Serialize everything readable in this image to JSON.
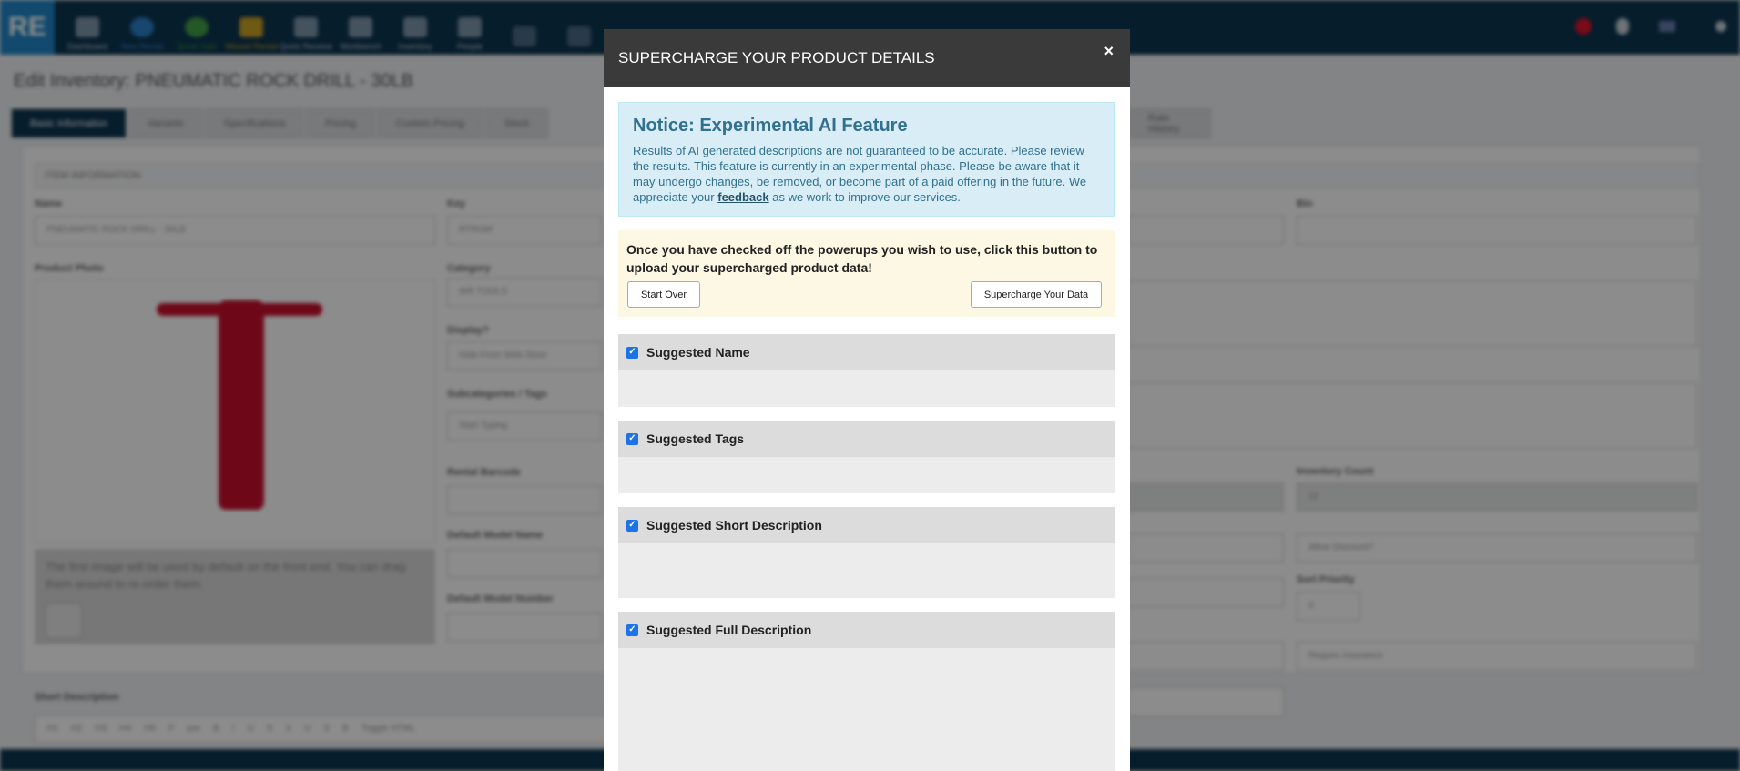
{
  "app": {
    "logo": "RE"
  },
  "nav": [
    {
      "label": "Dashboard",
      "icon": "dashboard-icon"
    },
    {
      "label": "New Rental",
      "icon": "new-rental-icon"
    },
    {
      "label": "Quick Sale",
      "icon": "quick-sale-icon"
    },
    {
      "label": "Missed Rental",
      "icon": "missed-rental-icon"
    },
    {
      "label": "Quick Receive",
      "icon": "quick-receive-icon"
    },
    {
      "label": "Workbench",
      "icon": "wrench-icon"
    },
    {
      "label": "Inventory",
      "icon": "inventory-icon"
    },
    {
      "label": "People",
      "icon": "people-icon"
    }
  ],
  "page": {
    "title": "Edit Inventory: PNEUMATIC ROCK DRILL - 30LB"
  },
  "tabs": [
    "Basic Information",
    "Variants",
    "Specifications",
    "Pricing",
    "Custom Pricing",
    "Stock",
    "Rate History"
  ],
  "form": {
    "section": "ITEM INFORMATION",
    "name_label": "Name",
    "name_value": "PNEUMATIC ROCK DRILL - 30LB",
    "key_label": "Key",
    "key_value": "RTROM",
    "bin_label": "Bin",
    "photo_label": "Product Photo",
    "category_label": "Category",
    "category_value": "AIR TOOLS",
    "display_label": "Display?",
    "display_value": "Hide From Web Store",
    "subcat_label": "Subcategories / Tags",
    "subcat_placeholder": "Start Typing",
    "barcode_label": "Rental Barcode",
    "model_name_label": "Default Model Name",
    "model_number_label": "Default Model Number",
    "inventory_count_label": "Inventory Count",
    "inventory_count_value": "12",
    "allow_discount": "Allow Discount?",
    "sort_priority_label": "Sort Priority",
    "sort_priority_value": "0",
    "require_insurance": "Require Insurance",
    "photo_hint": "The first image will be used by default on the front end. You can drag them around to re-order them.",
    "short_desc_label": "Short Description",
    "editor_buttons": [
      "H1",
      "H2",
      "H3",
      "H4",
      "H5",
      "P",
      "pre",
      "B",
      "I",
      "U",
      "S",
      "X",
      "U",
      "S",
      "B"
    ],
    "toggle_html": "Toggle HTML"
  },
  "modal": {
    "title": "SUPERCHARGE YOUR PRODUCT DETAILS",
    "close": "×",
    "notice_title": "Notice: Experimental AI Feature",
    "notice_before": "Results of AI generated descriptions are not guaranteed to be accurate. Please review the results. This feature is currently in an experimental phase. Please be aware that it may undergo changes, be removed, or become part of a paid offering in the future. We appreciate your ",
    "notice_link": "feedback",
    "notice_after": " as we work to improve our services.",
    "instruction": "Once you have checked off the powerups you wish to use, click this button to upload your supercharged product data!",
    "start_over": "Start Over",
    "supercharge": "Supercharge Your Data",
    "sections": [
      {
        "label": "Suggested Name",
        "checked": true
      },
      {
        "label": "Suggested Tags",
        "checked": true
      },
      {
        "label": "Suggested Short Description",
        "checked": true
      },
      {
        "label": "Suggested Full Description",
        "checked": true
      }
    ]
  },
  "colors": {
    "nav_bg": "#0c3550",
    "accent": "#1f87c8",
    "modal_header": "#3a3a3a",
    "notice_bg": "#d9edf7",
    "warn_bg": "#fcf8e3"
  }
}
